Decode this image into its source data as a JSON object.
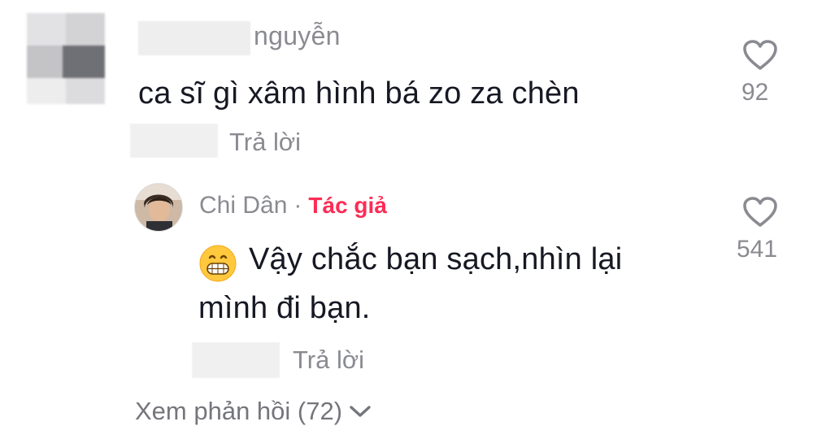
{
  "comment": {
    "username": "nguyễn",
    "text": "ca sĩ gì xâm hình bá zo za chèn",
    "reply_label": "Trả lời",
    "like_count": "92",
    "like_icon": "heart-outline-icon"
  },
  "reply": {
    "author": "Chi Dân",
    "separator": "·",
    "author_badge": "Tác giả",
    "badge_color": "#fe2c55",
    "emoji": "grinning-face-emoji",
    "text_line1": "Vậy chắc bạn sạch,nhìn lại",
    "text_line2": "mình đi bạn.",
    "reply_label": "Trả lời",
    "like_count": "541",
    "like_icon": "heart-outline-icon"
  },
  "view_replies": {
    "label": "Xem phản hồi (72)",
    "icon": "chevron-down-icon"
  }
}
